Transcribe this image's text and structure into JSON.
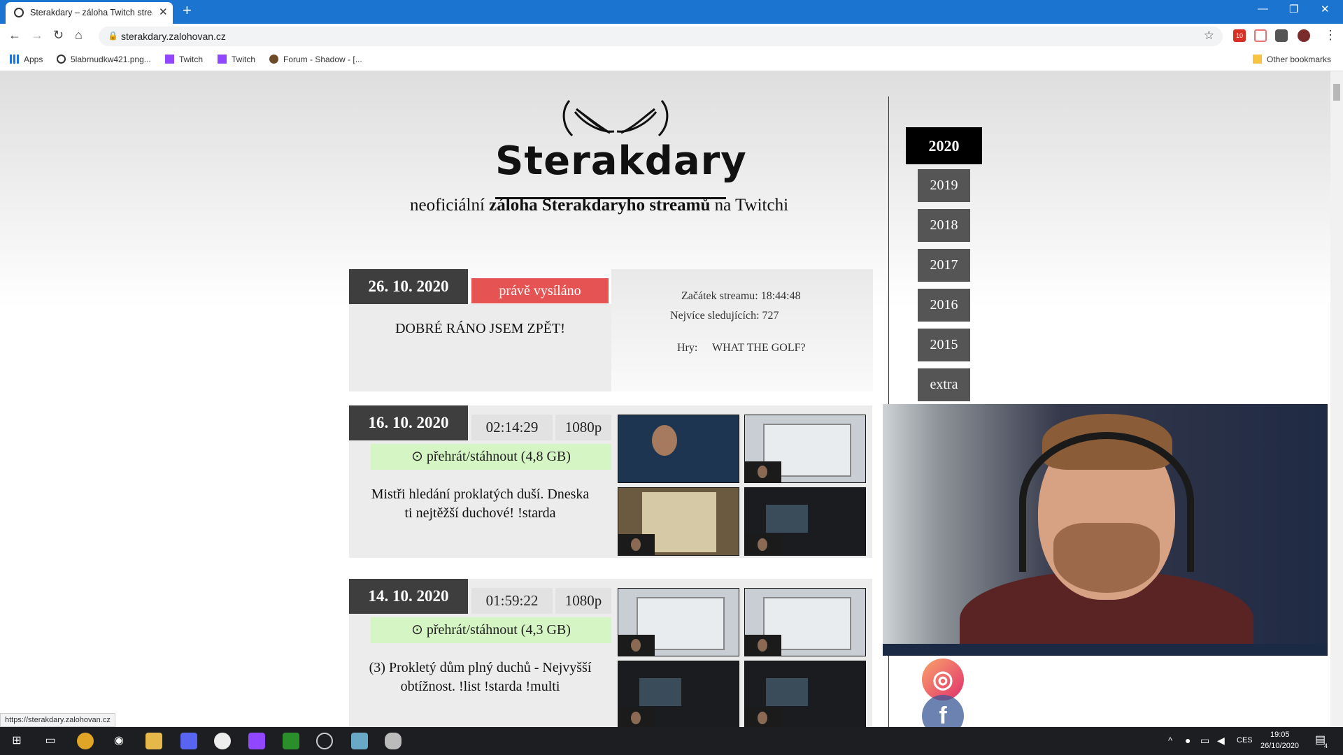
{
  "browser": {
    "tab_title": "Sterakdary – záloha Twitch stream",
    "url": "sterakdary.zalohovan.cz",
    "bookmarks": [
      "Apps",
      "5labrnudkw421.png...",
      "Twitch",
      "Twitch",
      "Forum - Shadow - [...",
      "Other bookmarks"
    ],
    "status_url": "https://sterakdary.zalohovan.cz",
    "ext_badge": "10"
  },
  "site": {
    "logo_text": "Sterakdary",
    "tagline_pre": "neoficiální ",
    "tagline_bold": "záloha Sterakdaryho streamů",
    "tagline_post": " na Twitchi"
  },
  "entries": [
    {
      "date": "26. 10. 2020",
      "live_label": "právě vysíláno",
      "title": "DOBRÉ RÁNO JSEM ZPĚT!",
      "start": "Začátek streamu: 18:44:48",
      "viewers": "Nejvíce sledujících: 727",
      "games_label": "Hry:",
      "games": "WHAT THE GOLF?"
    },
    {
      "date": "16. 10. 2020",
      "duration": "02:14:29",
      "quality": "1080p",
      "download": "přehrát/stáhnout (4,8 GB)",
      "desc_line1": "Mistři hledání proklatých duší. Dneska",
      "desc_line2": "ti nejtěžší duchové! !starda"
    },
    {
      "date": "14. 10. 2020",
      "duration": "01:59:22",
      "quality": "1080p",
      "download": "přehrát/stáhnout (4,3 GB)",
      "desc_line1": "(3) Prokletý dům plný duchů - Nejvyšší",
      "desc_line2": "obtížnost. !list !starda !multi"
    }
  ],
  "years": [
    "2020",
    "2019",
    "2018",
    "2017",
    "2016",
    "2015",
    "extra"
  ],
  "taskbar": {
    "language": "CES",
    "time": "19:05",
    "date": "26/10/2020",
    "notifications": "4"
  },
  "colors": {
    "live": "#e55353",
    "download": "#d6f5c4",
    "date_box": "#3e3e3e",
    "tab_bar": "#1a74d0"
  }
}
